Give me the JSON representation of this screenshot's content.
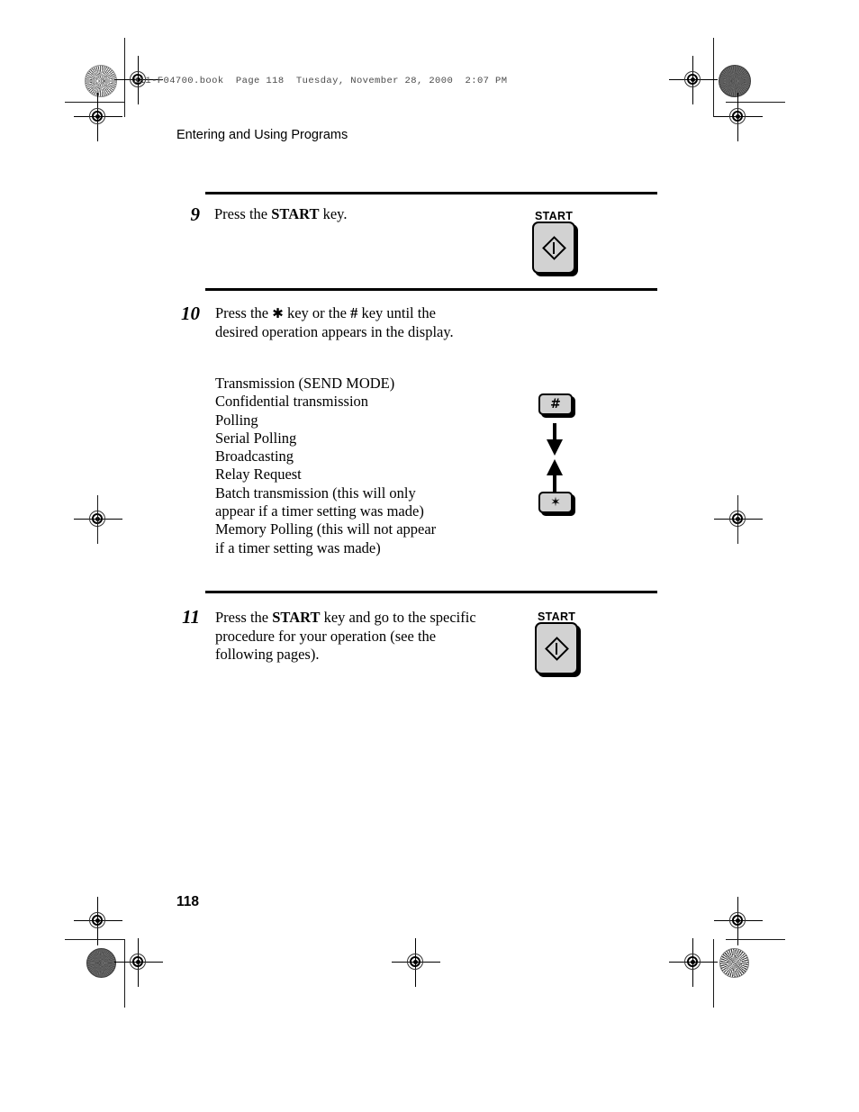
{
  "page": {
    "book_info": "a11-F04700.book  Page 118  Tuesday, November 28, 2000  2:07 PM",
    "running_head": "Entering and Using Programs",
    "folio": "118"
  },
  "steps": [
    {
      "number": "9",
      "text_html": "Press the <b>START</b> key.",
      "key_label": "START",
      "key_icon": "start-diamond-icon"
    },
    {
      "number": "10",
      "text_html": "Press the <span class=\"sym\">&#10033;</span> key or the <b>#</b> key until the desired operation appears in the display.",
      "keys": [
        {
          "label": "#",
          "icon": "hash-key-icon"
        },
        {
          "label": "✶",
          "icon": "asterisk-key-icon"
        }
      ],
      "operations": "Transmission (SEND MODE)\nConfidential transmission\nPolling\nSerial Polling\nBroadcasting\nRelay Request\nBatch transmission (this will only\nappear if a timer setting was made)\nMemory Polling (this will not appear\nif a timer setting was made)"
    },
    {
      "number": "11",
      "text_html": "Press the <b>START</b> key and go to the specific procedure for your operation (see the following pages).",
      "key_label": "START",
      "key_icon": "start-diamond-icon"
    }
  ],
  "colors": {
    "key_face": "#d2d2d2",
    "ink": "#000000",
    "mark_gray": "#4a4a4a"
  }
}
